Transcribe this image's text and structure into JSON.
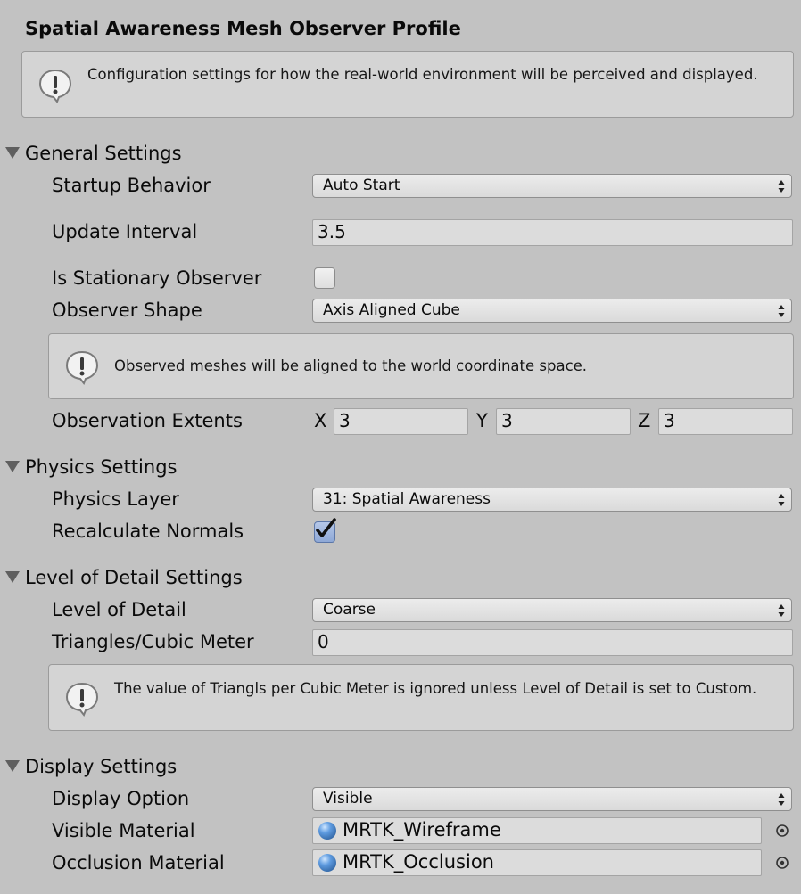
{
  "title": "Spatial Awareness Mesh Observer Profile",
  "header_help": "Configuration settings for how the real-world environment will be perceived and displayed.",
  "general": {
    "header": "General Settings",
    "startup_behavior": {
      "label": "Startup Behavior",
      "value": "Auto Start"
    },
    "update_interval": {
      "label": "Update Interval",
      "value": "3.5"
    },
    "is_stationary": {
      "label": "Is Stationary Observer",
      "checked": false
    },
    "observer_shape": {
      "label": "Observer Shape",
      "value": "Axis Aligned Cube"
    },
    "shape_help": "Observed meshes will be aligned to the world coordinate space.",
    "observation_extents": {
      "label": "Observation Extents",
      "x_label": "X",
      "x": "3",
      "y_label": "Y",
      "y": "3",
      "z_label": "Z",
      "z": "3"
    }
  },
  "physics": {
    "header": "Physics Settings",
    "physics_layer": {
      "label": "Physics Layer",
      "value": "31: Spatial Awareness"
    },
    "recalculate_normals": {
      "label": "Recalculate Normals",
      "checked": true
    }
  },
  "lod": {
    "header": "Level of Detail Settings",
    "level_of_detail": {
      "label": "Level of Detail",
      "value": "Coarse"
    },
    "triangles": {
      "label": "Triangles/Cubic Meter",
      "value": "0"
    },
    "lod_help": "The value of Triangls per Cubic Meter is ignored unless Level of Detail is set to Custom."
  },
  "display": {
    "header": "Display Settings",
    "display_option": {
      "label": "Display Option",
      "value": "Visible"
    },
    "visible_material": {
      "label": "Visible Material",
      "value": "MRTK_Wireframe"
    },
    "occlusion_material": {
      "label": "Occlusion Material",
      "value": "MRTK_Occlusion"
    }
  },
  "colors": {
    "background": "#c2c2c2",
    "checkbox_checked": "#8ea8d6"
  },
  "icons": [
    "warning-icon",
    "foldout-arrow-icon",
    "dropdown-arrows-icon",
    "checkmark-icon",
    "material-sphere-icon",
    "object-picker-icon"
  ]
}
